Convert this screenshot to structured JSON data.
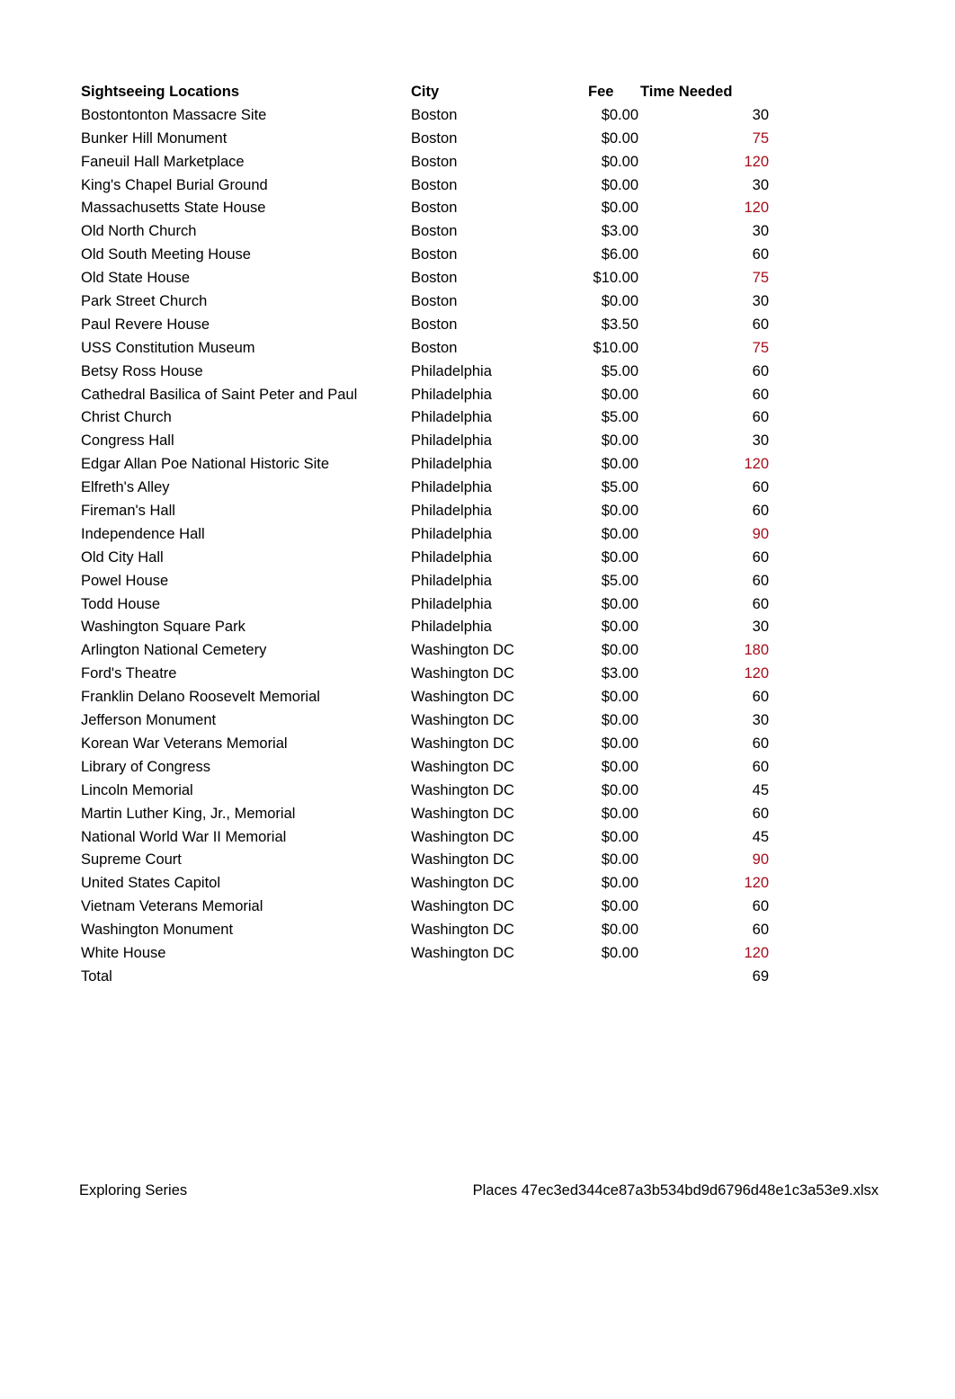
{
  "header": {
    "location": "Sightseeing Locations",
    "city": "City",
    "fee": "Fee",
    "time": "Time Needed"
  },
  "highlight_color": "#a50e1a",
  "rows": [
    {
      "location": "Bostontonton Massacre Site",
      "city": "Boston",
      "fee": "$0.00",
      "time": "30",
      "highlight": false
    },
    {
      "location": "Bunker Hill Monument",
      "city": "Boston",
      "fee": "$0.00",
      "time": "75",
      "highlight": true
    },
    {
      "location": "Faneuil Hall Marketplace",
      "city": "Boston",
      "fee": "$0.00",
      "time": "120",
      "highlight": true
    },
    {
      "location": "King's Chapel Burial Ground",
      "city": "Boston",
      "fee": "$0.00",
      "time": "30",
      "highlight": false
    },
    {
      "location": "Massachusetts State House",
      "city": "Boston",
      "fee": "$0.00",
      "time": "120",
      "highlight": true
    },
    {
      "location": "Old North Church",
      "city": "Boston",
      "fee": "$3.00",
      "time": "30",
      "highlight": false
    },
    {
      "location": "Old South Meeting House",
      "city": "Boston",
      "fee": "$6.00",
      "time": "60",
      "highlight": false
    },
    {
      "location": "Old State House",
      "city": "Boston",
      "fee": "$10.00",
      "time": "75",
      "highlight": true
    },
    {
      "location": "Park Street Church",
      "city": "Boston",
      "fee": "$0.00",
      "time": "30",
      "highlight": false
    },
    {
      "location": "Paul Revere House",
      "city": "Boston",
      "fee": "$3.50",
      "time": "60",
      "highlight": false
    },
    {
      "location": "USS Constitution Museum",
      "city": "Boston",
      "fee": "$10.00",
      "time": "75",
      "highlight": true
    },
    {
      "location": "Betsy Ross House",
      "city": "Philadelphia",
      "fee": "$5.00",
      "time": "60",
      "highlight": false
    },
    {
      "location": "Cathedral Basilica of Saint Peter and Paul",
      "city": "Philadelphia",
      "fee": "$0.00",
      "time": "60",
      "highlight": false
    },
    {
      "location": "Christ Church",
      "city": "Philadelphia",
      "fee": "$5.00",
      "time": "60",
      "highlight": false
    },
    {
      "location": "Congress Hall",
      "city": "Philadelphia",
      "fee": "$0.00",
      "time": "30",
      "highlight": false
    },
    {
      "location": "Edgar Allan Poe National Historic Site",
      "city": "Philadelphia",
      "fee": "$0.00",
      "time": "120",
      "highlight": true
    },
    {
      "location": "Elfreth's Alley",
      "city": "Philadelphia",
      "fee": "$5.00",
      "time": "60",
      "highlight": false
    },
    {
      "location": "Fireman's Hall",
      "city": "Philadelphia",
      "fee": "$0.00",
      "time": "60",
      "highlight": false
    },
    {
      "location": "Independence Hall",
      "city": "Philadelphia",
      "fee": "$0.00",
      "time": "90",
      "highlight": true
    },
    {
      "location": "Old City Hall",
      "city": "Philadelphia",
      "fee": "$0.00",
      "time": "60",
      "highlight": false
    },
    {
      "location": "Powel House",
      "city": "Philadelphia",
      "fee": "$5.00",
      "time": "60",
      "highlight": false
    },
    {
      "location": "Todd House",
      "city": "Philadelphia",
      "fee": "$0.00",
      "time": "60",
      "highlight": false
    },
    {
      "location": "Washington Square Park",
      "city": "Philadelphia",
      "fee": "$0.00",
      "time": "30",
      "highlight": false
    },
    {
      "location": "Arlington National Cemetery",
      "city": "Washington DC",
      "fee": "$0.00",
      "time": "180",
      "highlight": true
    },
    {
      "location": "Ford's Theatre",
      "city": "Washington DC",
      "fee": "$3.00",
      "time": "120",
      "highlight": true
    },
    {
      "location": "Franklin Delano Roosevelt Memorial",
      "city": "Washington DC",
      "fee": "$0.00",
      "time": "60",
      "highlight": false
    },
    {
      "location": "Jefferson Monument",
      "city": "Washington DC",
      "fee": "$0.00",
      "time": "30",
      "highlight": false
    },
    {
      "location": "Korean War Veterans Memorial",
      "city": "Washington DC",
      "fee": "$0.00",
      "time": "60",
      "highlight": false
    },
    {
      "location": "Library of Congress",
      "city": "Washington DC",
      "fee": "$0.00",
      "time": "60",
      "highlight": false
    },
    {
      "location": "Lincoln Memorial",
      "city": "Washington DC",
      "fee": "$0.00",
      "time": "45",
      "highlight": false
    },
    {
      "location": "Martin Luther King, Jr., Memorial",
      "city": "Washington DC",
      "fee": "$0.00",
      "time": "60",
      "highlight": false
    },
    {
      "location": "National World War II Memorial",
      "city": "Washington DC",
      "fee": "$0.00",
      "time": "45",
      "highlight": false
    },
    {
      "location": "Supreme Court",
      "city": "Washington DC",
      "fee": "$0.00",
      "time": "90",
      "highlight": true
    },
    {
      "location": "United States Capitol",
      "city": "Washington DC",
      "fee": "$0.00",
      "time": "120",
      "highlight": true
    },
    {
      "location": "Vietnam Veterans Memorial",
      "city": "Washington DC",
      "fee": "$0.00",
      "time": "60",
      "highlight": false
    },
    {
      "location": "Washington Monument",
      "city": "Washington DC",
      "fee": "$0.00",
      "time": "60",
      "highlight": false
    },
    {
      "location": "White House",
      "city": "Washington DC",
      "fee": "$0.00",
      "time": "120",
      "highlight": true
    }
  ],
  "total": {
    "label": "Total",
    "time": "69"
  },
  "footer": {
    "left": "Exploring Series",
    "right": "Places 47ec3ed344ce87a3b534bd9d6796d48e1c3a53e9.xlsx"
  }
}
